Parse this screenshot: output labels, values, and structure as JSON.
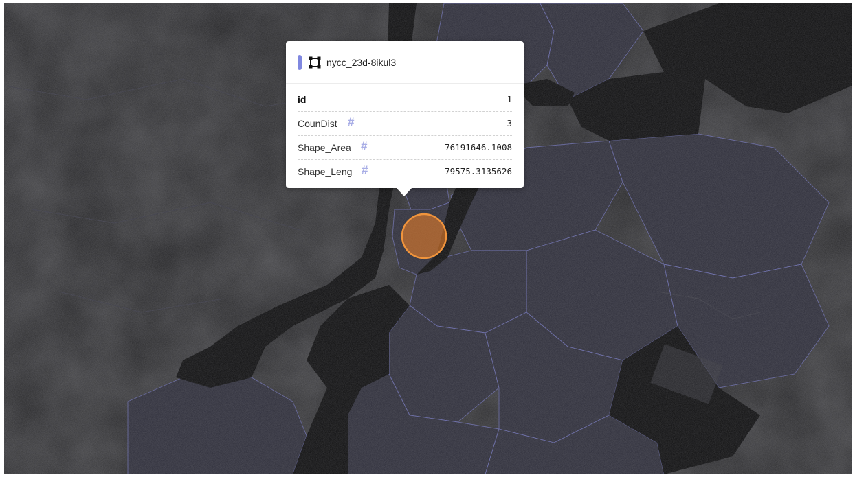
{
  "map": {
    "basemap": "dark-satellite",
    "boundary_color": "#6f72b8",
    "highlight": {
      "fill_color": "#e07b2a",
      "stroke_color": "#f0943c"
    }
  },
  "tooltip": {
    "layer_color": "#8088e0",
    "layer_icon": "polygon-icon",
    "layer_name": "nycc_23d-8ikul3",
    "number_icon": "#",
    "rows": [
      {
        "label": "id",
        "value": "1",
        "bold": true,
        "numeric_icon": false
      },
      {
        "label": "CounDist",
        "value": "3",
        "bold": false,
        "numeric_icon": true
      },
      {
        "label": "Shape_Area",
        "value": "76191646.1008",
        "bold": false,
        "numeric_icon": true
      },
      {
        "label": "Shape_Leng",
        "value": "79575.3135626",
        "bold": false,
        "numeric_icon": true
      }
    ]
  }
}
